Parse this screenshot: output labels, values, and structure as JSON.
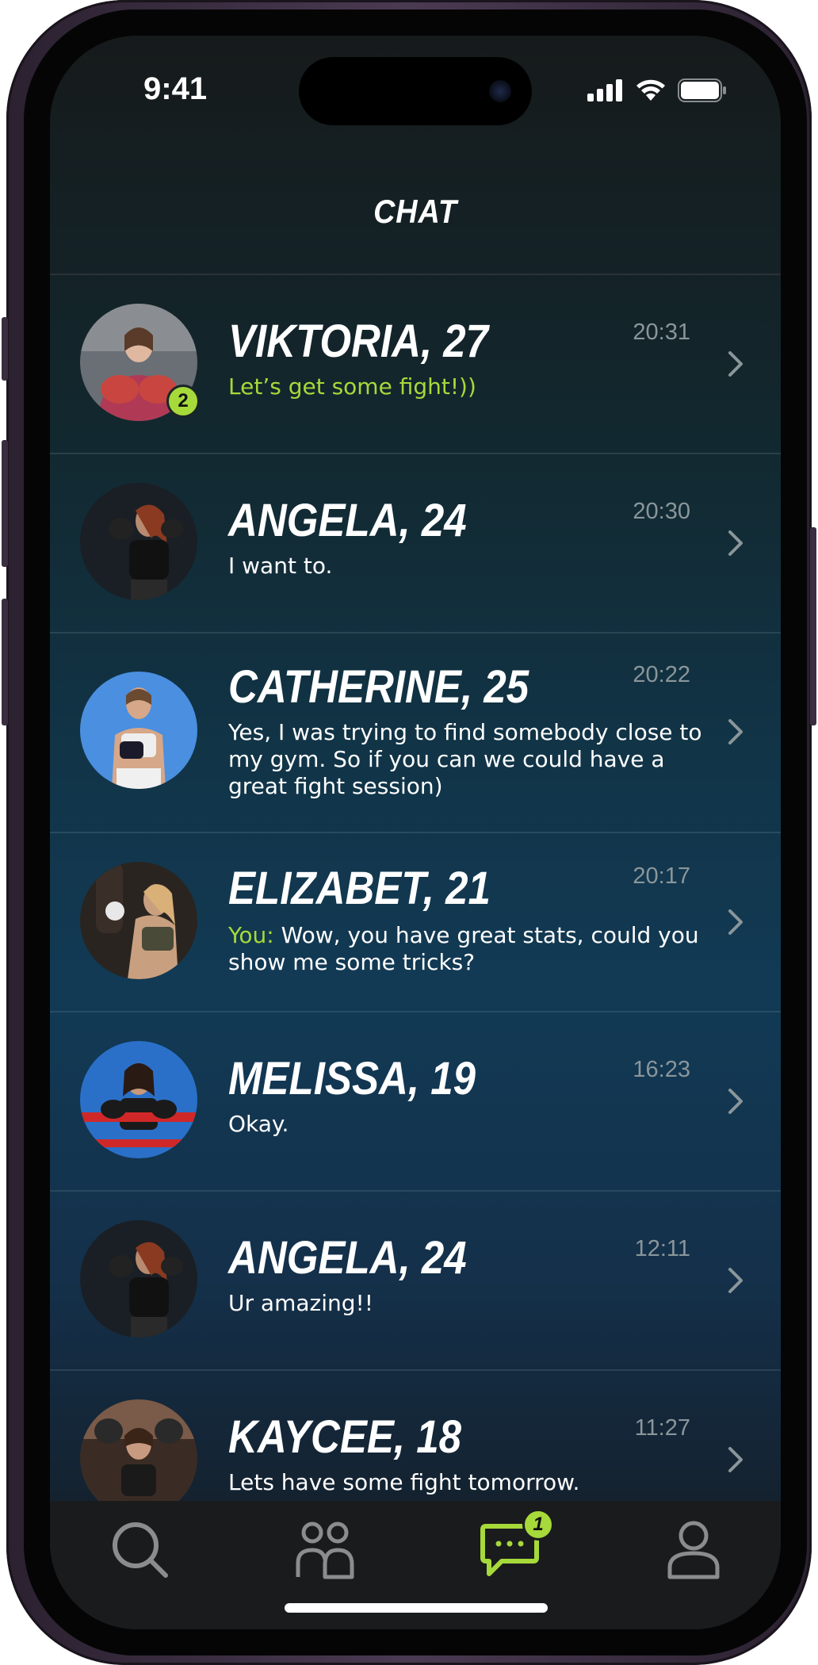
{
  "status_bar": {
    "time": "9:41"
  },
  "header": {
    "title": "CHAT"
  },
  "chats": [
    {
      "name": "VIKTORIA, 27",
      "time": "20:31",
      "prefix": "",
      "message": "Let’s get some fight!))",
      "unread": "2",
      "message_highlight": true,
      "avatar_colors": [
        "#6a6f75",
        "#c8463f",
        "#e0b8a0"
      ]
    },
    {
      "name": "ANGELA, 24",
      "time": "20:30",
      "prefix": "",
      "message": "I want to.",
      "unread": "",
      "message_highlight": false,
      "avatar_colors": [
        "#1a1f25",
        "#3a2a26",
        "#b88a70"
      ]
    },
    {
      "name": "CATHERINE, 25",
      "time": "20:22",
      "prefix": "",
      "message": "Yes, I was trying to find somebody close to my gym. So if you can we could have a great fight session)",
      "unread": "",
      "message_highlight": false,
      "avatar_colors": [
        "#4a8fe0",
        "#e8e8e8",
        "#d6a788"
      ]
    },
    {
      "name": "ELIZABET, 21",
      "time": "20:17",
      "prefix": "You:",
      "message": "Wow, you have great stats, could you show me some tricks?",
      "unread": "",
      "message_highlight": false,
      "avatar_colors": [
        "#2a2420",
        "#d8b078",
        "#c8a080"
      ]
    },
    {
      "name": "MELISSA, 19",
      "time": "16:23",
      "prefix": "",
      "message": "Okay.",
      "unread": "",
      "message_highlight": false,
      "avatar_colors": [
        "#2a70c8",
        "#d02828",
        "#c89878"
      ]
    },
    {
      "name": "ANGELA, 24",
      "time": "12:11",
      "prefix": "",
      "message": "Ur amazing!!",
      "unread": "",
      "message_highlight": false,
      "avatar_colors": [
        "#1a1f25",
        "#3a2a26",
        "#b88a70"
      ]
    },
    {
      "name": "KAYCEE, 18",
      "time": "11:27",
      "prefix": "",
      "message": "Lets have some fight tomorrow.",
      "unread": "",
      "message_highlight": false,
      "avatar_colors": [
        "#3a2c24",
        "#7a5a48",
        "#c89a80"
      ]
    }
  ],
  "tabbar": {
    "tabs": [
      {
        "icon": "search-icon",
        "label": "Search",
        "active": false
      },
      {
        "icon": "people-icon",
        "label": "Partners",
        "active": false
      },
      {
        "icon": "chat-icon",
        "label": "Chat",
        "active": true,
        "badge": "1"
      },
      {
        "icon": "profile-icon",
        "label": "Profile",
        "active": false
      }
    ]
  },
  "colors": {
    "accent": "#a6d93a",
    "muted": "#8a969a",
    "text": "#ffffff"
  }
}
